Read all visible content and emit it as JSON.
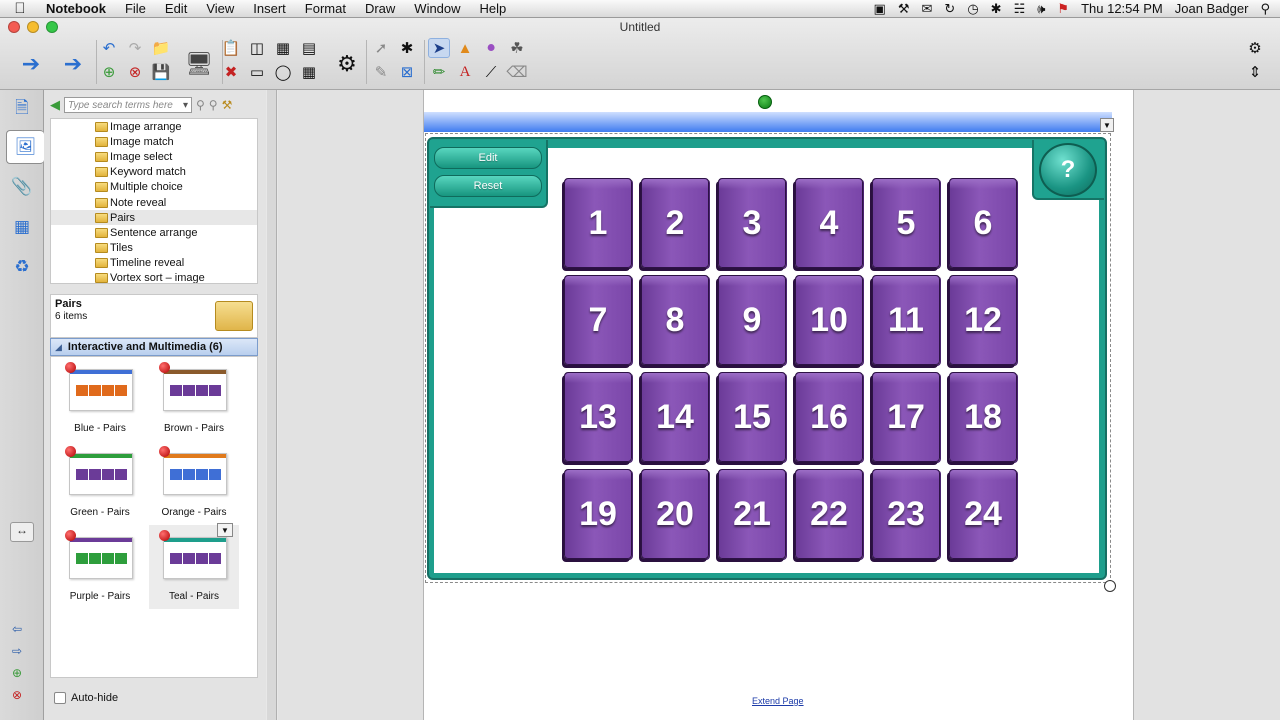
{
  "menubar": {
    "apple": "",
    "app": "Notebook",
    "items": [
      "File",
      "Edit",
      "View",
      "Insert",
      "Format",
      "Draw",
      "Window",
      "Help"
    ],
    "clock": "Thu 12:54 PM",
    "user": "Joan Badger"
  },
  "window": {
    "title": "Untitled"
  },
  "gallery": {
    "search_placeholder": "Type search terms here",
    "tree": [
      "Image arrange",
      "Image match",
      "Image select",
      "Keyword match",
      "Multiple choice",
      "Note reveal",
      "Pairs",
      "Sentence arrange",
      "Tiles",
      "Timeline reveal",
      "Vortex sort – image"
    ],
    "selected_folder": "Pairs",
    "info": {
      "title": "Pairs",
      "count": "6 items"
    },
    "category": "Interactive and Multimedia (6)",
    "thumbs": [
      {
        "label": "Blue - Pairs",
        "bar": "#3f6fd6",
        "cell": "#e06a1c"
      },
      {
        "label": "Brown - Pairs",
        "bar": "#8a5a2b",
        "cell": "#6b3b98"
      },
      {
        "label": "Green - Pairs",
        "bar": "#2e9e3c",
        "cell": "#6b3b98"
      },
      {
        "label": "Orange - Pairs",
        "bar": "#e07a1c",
        "cell": "#3f6fd6"
      },
      {
        "label": "Purple - Pairs",
        "bar": "#6b3b98",
        "cell": "#2e9e3c"
      },
      {
        "label": "Teal - Pairs",
        "bar": "#1e9e8c",
        "cell": "#6b3b98"
      }
    ],
    "autohide": "Auto-hide"
  },
  "activity": {
    "edit": "Edit",
    "reset": "Reset",
    "help": "?",
    "cards": [
      "1",
      "2",
      "3",
      "4",
      "5",
      "6",
      "7",
      "8",
      "9",
      "10",
      "11",
      "12",
      "13",
      "14",
      "15",
      "16",
      "17",
      "18",
      "19",
      "20",
      "21",
      "22",
      "23",
      "24"
    ]
  },
  "page": {
    "extend_link": "Extend Page"
  },
  "colors": {
    "card": "#7a46a9",
    "teal": "#1e9e8c",
    "title_bar": "#3f7cf0"
  }
}
